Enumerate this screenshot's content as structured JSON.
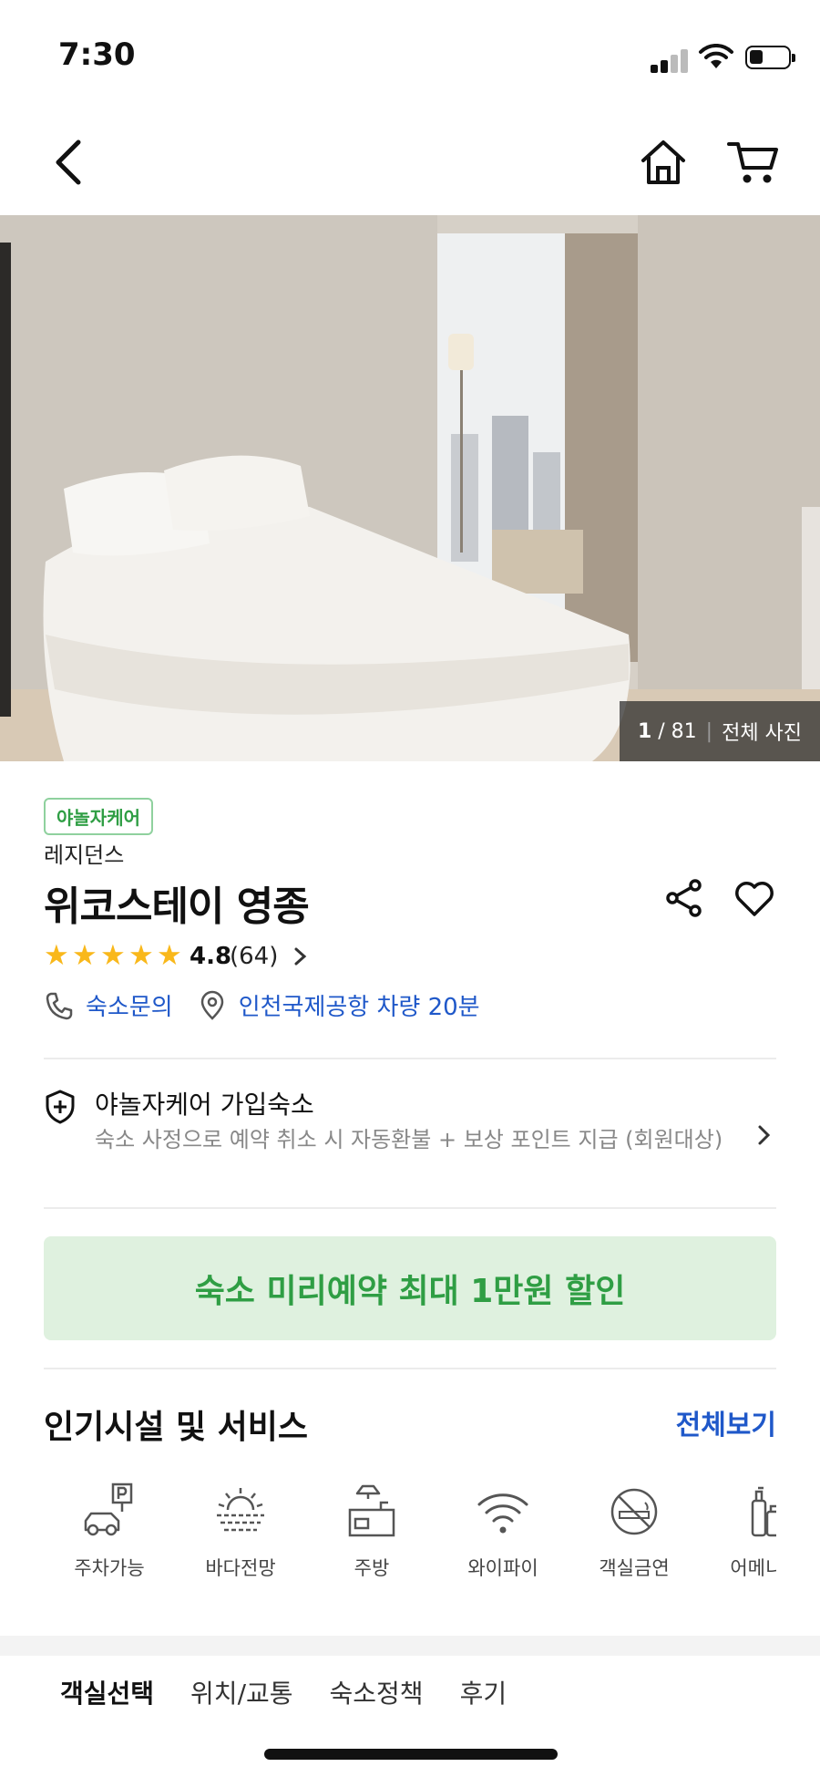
{
  "status_bar": {
    "time": "7:30"
  },
  "hero": {
    "current": "1",
    "total": "/ 81",
    "all_photos": "전체 사진"
  },
  "info": {
    "care_tag": "야놀자케어",
    "category": "레지던스",
    "title": "위코스테이 영종",
    "rating": "4.8",
    "rating_count": "(64)",
    "stars": 5,
    "contact": "숙소문의",
    "location": "인천국제공항 차량 20분"
  },
  "care_row": {
    "heading": "야놀자케어 가입숙소",
    "description": "숙소 사정으로 예약 취소 시 자동환불 + 보상 포인트 지급 (회원대상)"
  },
  "promo": {
    "label": "숙소 미리예약 최대 1만원 할인"
  },
  "facilities": {
    "title": "인기시설 및 서비스",
    "see_all": "전체보기",
    "items": [
      {
        "label": "주차가능",
        "icon": "parking-icon"
      },
      {
        "label": "바다전망",
        "icon": "ocean-view-icon"
      },
      {
        "label": "주방",
        "icon": "kitchen-icon"
      },
      {
        "label": "와이파이",
        "icon": "wifi-icon"
      },
      {
        "label": "객실금연",
        "icon": "no-smoking-icon"
      },
      {
        "label": "어메니티",
        "icon": "amenities-icon"
      }
    ]
  },
  "tabs": [
    "객실선택",
    "위치/교통",
    "숙소정책",
    "후기"
  ],
  "colors": {
    "accent_blue": "#1f58c9",
    "care_green": "#2f9e44",
    "promo_bg": "#dff1df",
    "star": "#f9b81b"
  }
}
